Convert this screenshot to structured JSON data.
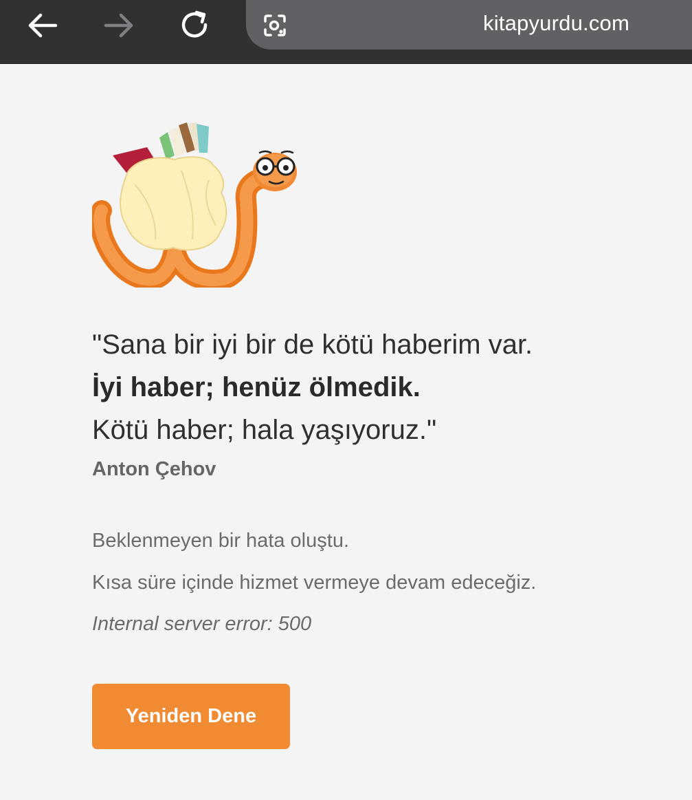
{
  "browser": {
    "url": "kitapyurdu.com",
    "icons": {
      "back": "arrow-left-icon",
      "forward": "arrow-right-icon",
      "reload": "reload-icon",
      "lens": "lens-camera-icon"
    }
  },
  "error_page": {
    "quote": {
      "line1": "\"Sana bir iyi bir de kötü haberim var.",
      "line2": "İyi haber; henüz ölmedik.",
      "line3": "Kötü haber; hala yaşıyoruz.\""
    },
    "author": "Anton Çehov",
    "messages": {
      "line1": "Beklenmeyen bir hata oluştu.",
      "line2": "Kısa süre içinde hizmet vermeye devam edeceğiz.",
      "line3": "Internal server error: 500"
    },
    "retry_button": "Yeniden Dene",
    "colors": {
      "accent": "#f08a33",
      "worm": "#f08a33",
      "sack": "#fdeeb5"
    }
  }
}
